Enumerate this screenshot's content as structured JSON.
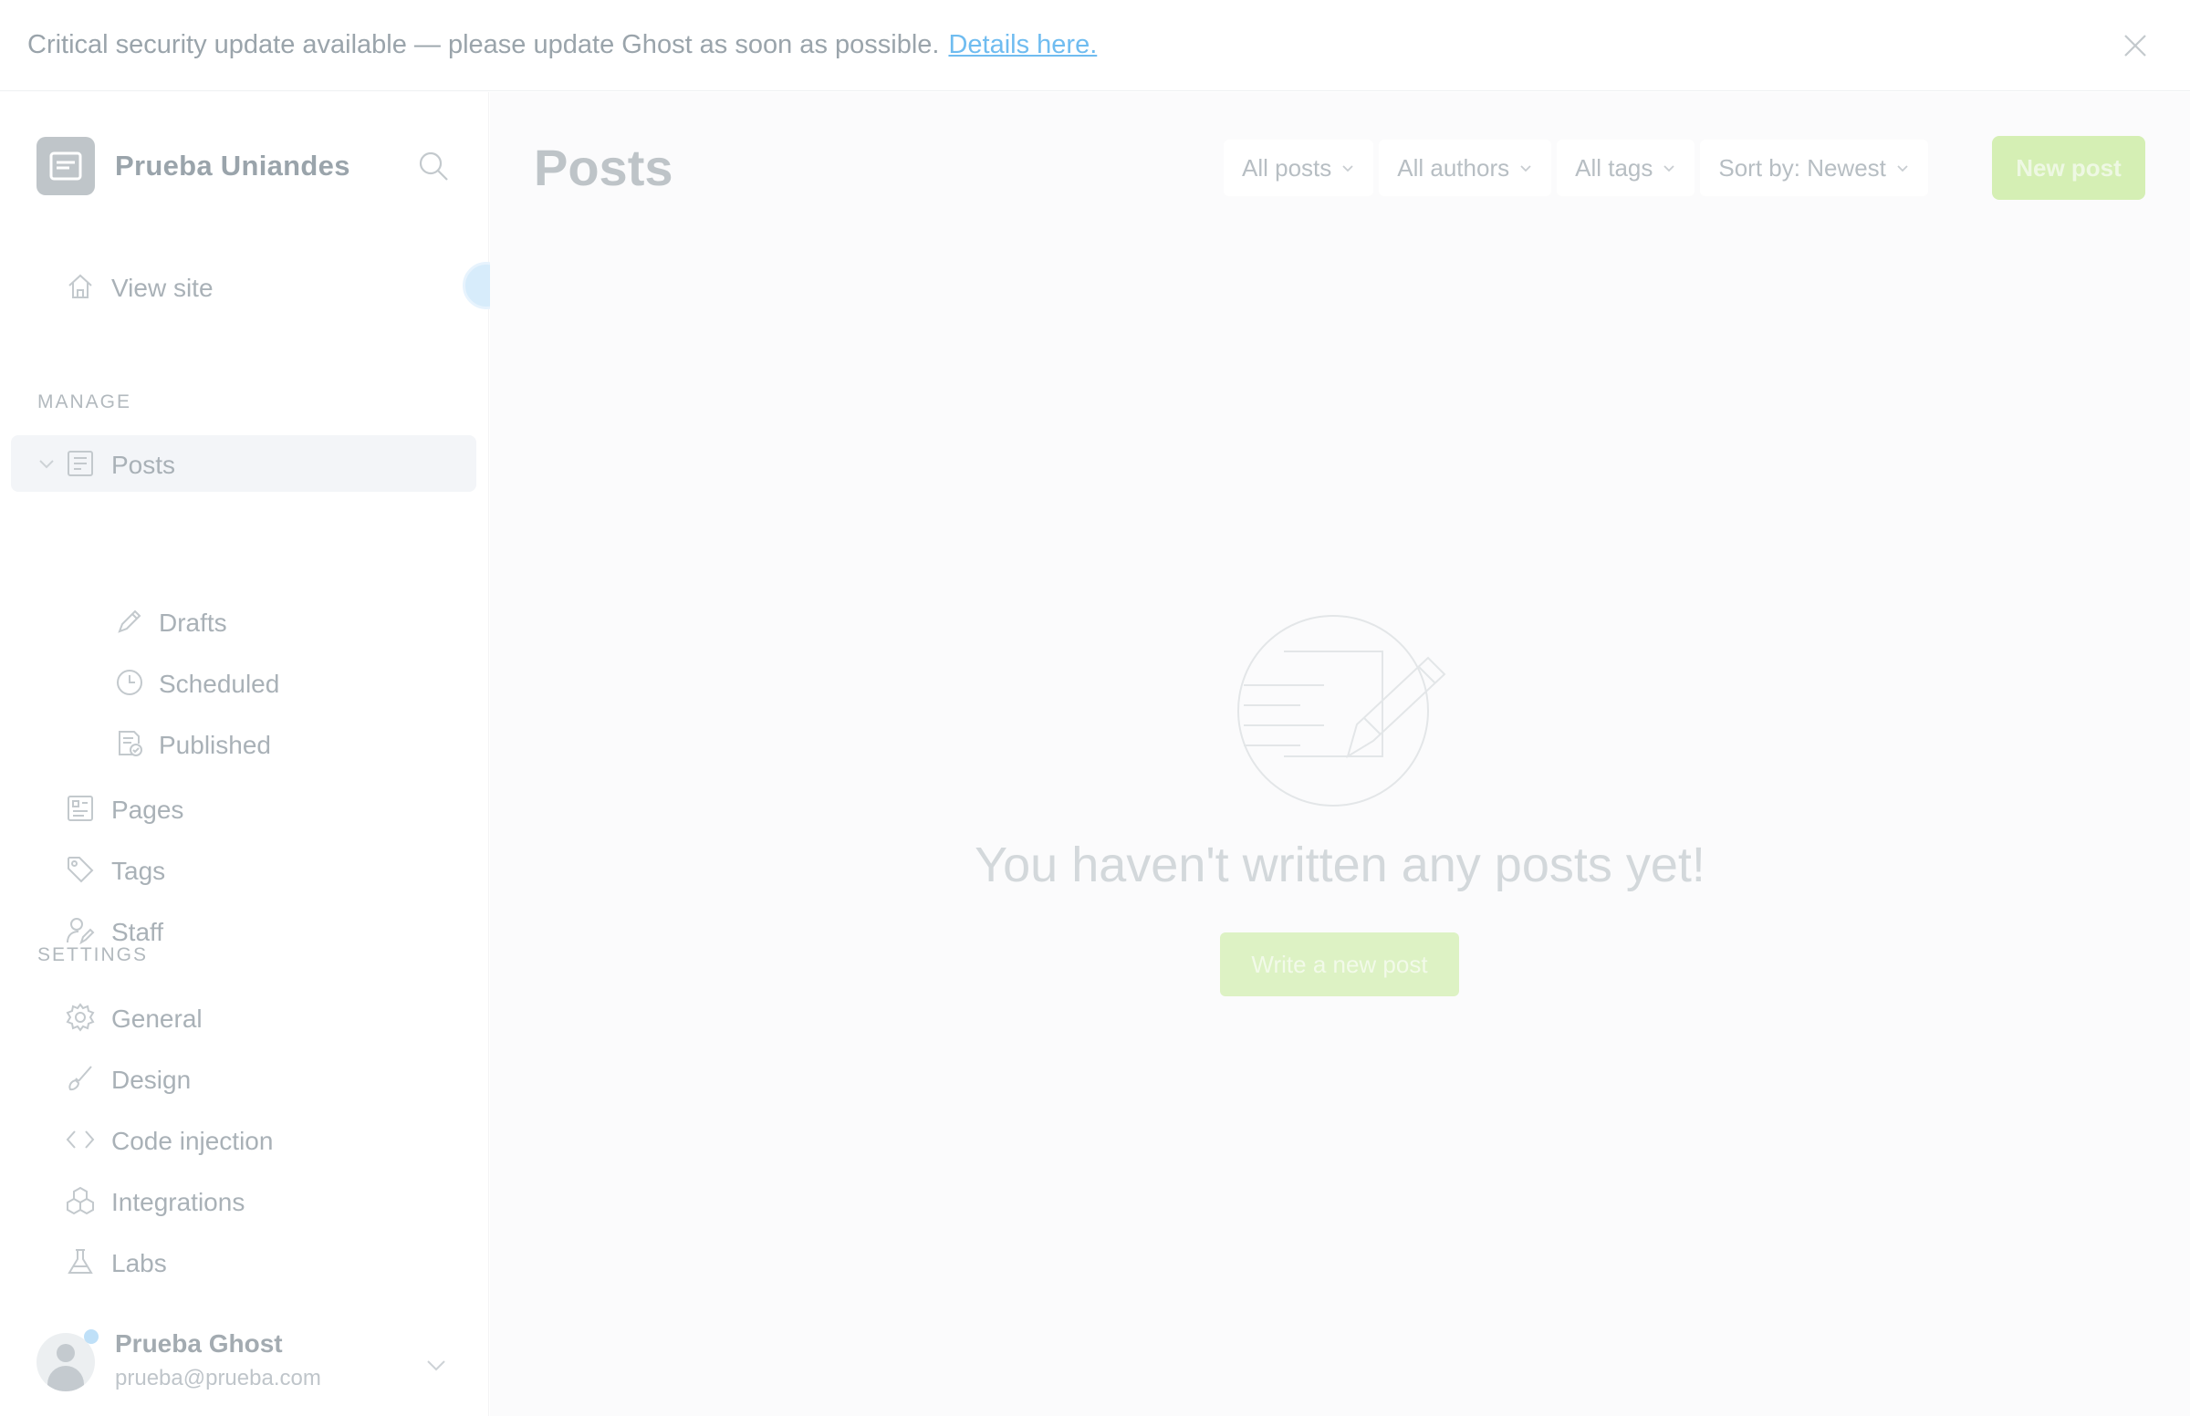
{
  "banner": {
    "text": "Critical security update available — please update Ghost as soon as possible.",
    "link": "Details here."
  },
  "sidebar": {
    "brand": "Prueba Uniandes",
    "view_site": "View site",
    "manage_heading": "MANAGE",
    "manage": [
      {
        "label": "Posts",
        "icon": "posts-icon",
        "active": true
      },
      {
        "label": "Drafts",
        "icon": "pencil-icon"
      },
      {
        "label": "Scheduled",
        "icon": "clock-icon"
      },
      {
        "label": "Published",
        "icon": "published-icon"
      },
      {
        "label": "Pages",
        "icon": "pages-icon"
      },
      {
        "label": "Tags",
        "icon": "tag-icon"
      },
      {
        "label": "Staff",
        "icon": "staff-icon"
      }
    ],
    "settings_heading": "SETTINGS",
    "settings": [
      {
        "label": "General",
        "icon": "gear-icon"
      },
      {
        "label": "Design",
        "icon": "brush-icon"
      },
      {
        "label": "Code injection",
        "icon": "code-icon"
      },
      {
        "label": "Integrations",
        "icon": "integrations-icon"
      },
      {
        "label": "Labs",
        "icon": "flask-icon"
      }
    ],
    "user": {
      "name": "Prueba Ghost",
      "email": "prueba@prueba.com"
    }
  },
  "main": {
    "title": "Posts",
    "filters": {
      "type": "All posts",
      "author": "All authors",
      "tag": "All tags",
      "sort": "Sort by: Newest"
    },
    "new_post": "New post",
    "empty_message": "You haven't written any posts yet!",
    "write_button": "Write a new post"
  },
  "colors": {
    "accent_green": "#d5efb4",
    "link_blue": "#6fbcf0"
  }
}
